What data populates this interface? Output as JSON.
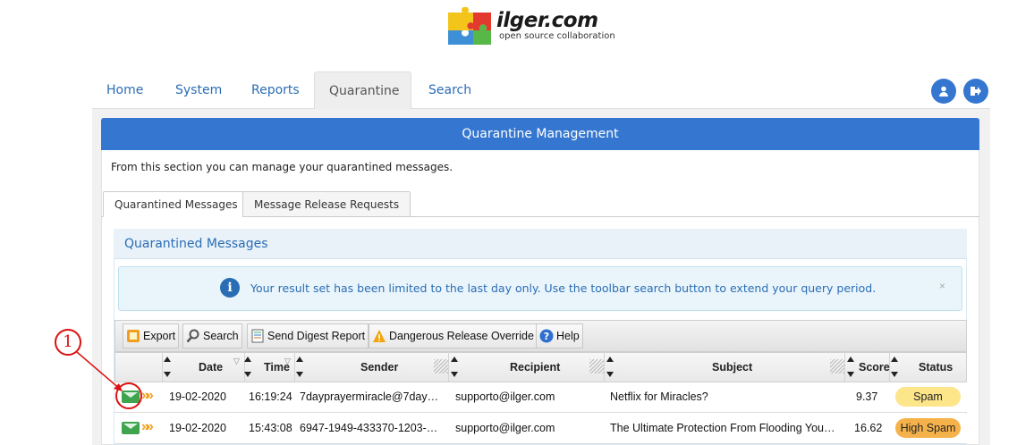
{
  "logo": {
    "text": "ilger.com",
    "subtitle": "open source collaboration"
  },
  "nav": {
    "tabs": [
      {
        "label": "Home"
      },
      {
        "label": "System"
      },
      {
        "label": "Reports"
      },
      {
        "label": "Quarantine",
        "active": true
      },
      {
        "label": "Search"
      }
    ],
    "user_icon": "user-icon",
    "logout_icon": "logout-icon"
  },
  "panel": {
    "title": "Quarantine Management",
    "description": "From this section you can manage your quarantined messages."
  },
  "subtabs": [
    {
      "label": "Quarantined Messages",
      "active": true
    },
    {
      "label": "Message Release Requests"
    }
  ],
  "quarantine": {
    "title": "Quarantined Messages",
    "alert": {
      "text": "Your result set has been limited to the last day only. Use the toolbar search button to extend your query period.",
      "close": "×"
    }
  },
  "toolbar": {
    "export": "Export",
    "search": "Search",
    "digest": "Send Digest Report",
    "override": "Dangerous Release Override",
    "help": "Help"
  },
  "table": {
    "headers": {
      "date": "Date",
      "time": "Time",
      "sender": "Sender",
      "recipient": "Recipient",
      "subject": "Subject",
      "score": "Score",
      "status": "Status"
    },
    "rows": [
      {
        "date": "19-02-2020",
        "time": "16:19:24",
        "sender": "7dayprayermiracle@7day…",
        "recipient": "supporto@ilger.com",
        "subject": "Netflix for Miracles?",
        "score": "9.37",
        "status": "Spam",
        "status_color": "#fde58a"
      },
      {
        "date": "19-02-2020",
        "time": "15:43:08",
        "sender": "6947-1949-433370-1203-…",
        "recipient": "supporto@ilger.com",
        "subject": "The Ultimate Protection From Flooding You…",
        "score": "16.62",
        "status": "High Spam",
        "status_color": "#f6b24a"
      }
    ]
  },
  "annotation": {
    "label": "1"
  },
  "colors": {
    "primary": "#3577d0",
    "link": "#2a6db5",
    "annotation": "#dd1111"
  }
}
